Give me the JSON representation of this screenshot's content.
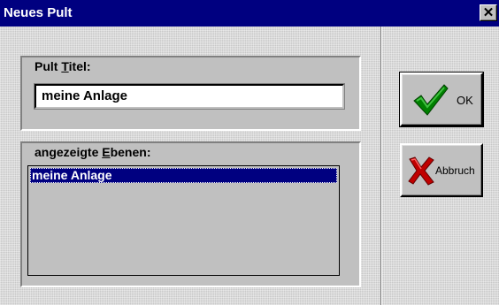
{
  "window": {
    "title": "Neues Pult",
    "close_glyph": "✕"
  },
  "title_group": {
    "label_prefix": "Pult ",
    "label_underlined": "T",
    "label_suffix": "itel:",
    "value": "meine Anlage"
  },
  "layers_group": {
    "label_prefix": "angezeigte ",
    "label_underlined": "E",
    "label_suffix": "benen:",
    "items": [
      "meine Anlage"
    ],
    "selected_index": 0
  },
  "buttons": {
    "ok_label": "OK",
    "cancel_label": "Abbruch"
  },
  "icons": {
    "ok": "check-icon",
    "cancel": "x-icon"
  },
  "colors": {
    "titlebar": "#000080",
    "selection": "#000080",
    "check_green": "#008000",
    "x_red": "#c00000"
  }
}
